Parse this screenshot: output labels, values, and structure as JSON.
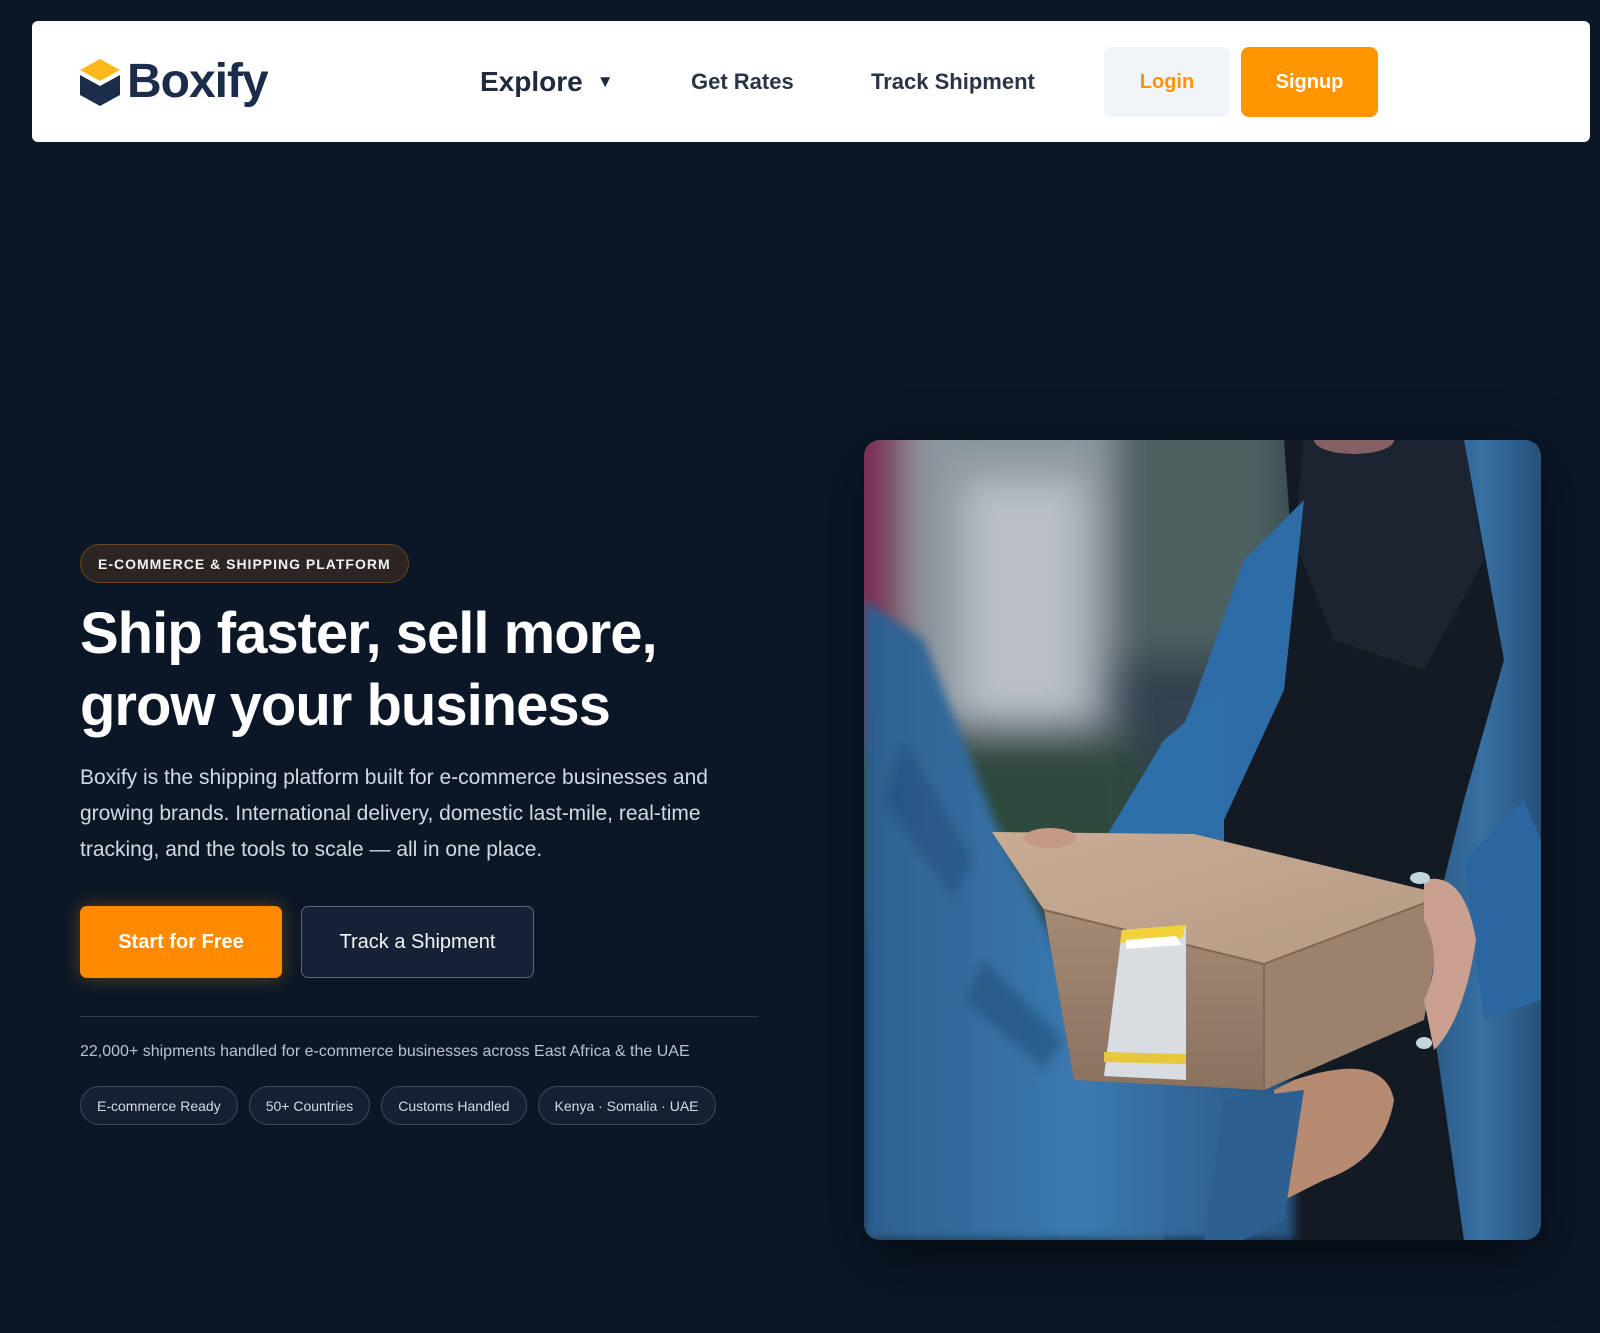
{
  "nav": {
    "brand": "Boxify",
    "explore_label": "Explore",
    "links": [
      "Get Rates",
      "Track Shipment"
    ],
    "login_label": "Login",
    "signup_label": "Signup"
  },
  "hero": {
    "badge": "E-COMMERCE & SHIPPING PLATFORM",
    "title_line1": "Ship faster, sell more,",
    "title_line2": "grow your business",
    "description": "Boxify is the shipping platform built for e-commerce businesses and growing brands. International delivery, domestic last-mile, real-time tracking, and the tools to scale — all in one place.",
    "primary_cta": "Start for Free",
    "secondary_cta": "Track a Shipment",
    "stat_text": "22,000+ shipments handled for e-commerce businesses across East Africa & the UAE",
    "pills": [
      "E-commerce Ready",
      "50+ Countries",
      "Customs Handled",
      "Kenya · Somalia · UAE"
    ]
  },
  "colors": {
    "background": "#0b1727",
    "accent": "#ff9500",
    "brand_navy": "#1b2d4b"
  },
  "icons": {
    "logo": "box-logo-icon",
    "explore_caret": "caret-down-icon"
  }
}
